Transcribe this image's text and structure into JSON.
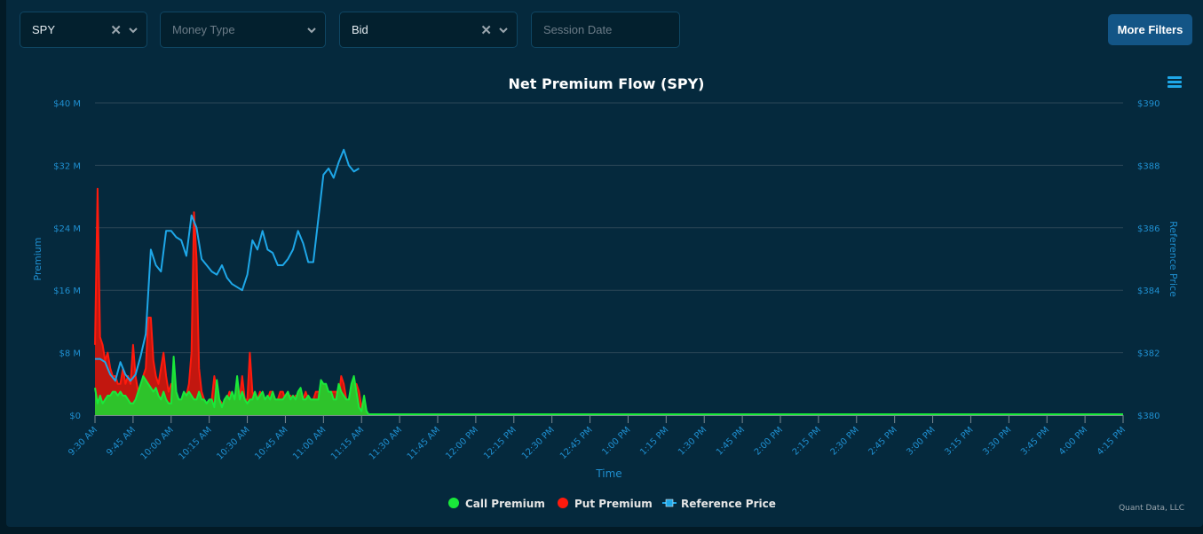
{
  "filters": {
    "ticker": {
      "value": "SPY",
      "clearable": true
    },
    "money_type": {
      "placeholder": "Money Type"
    },
    "side": {
      "value": "Bid",
      "clearable": true
    },
    "session_date": {
      "placeholder": "Session Date"
    },
    "more_filters_label": "More Filters"
  },
  "menu_icon": "hamburger-menu-icon",
  "credit": "Quant Data, LLC",
  "colors": {
    "call": "#19e93a",
    "call_fill": "#2ec32b",
    "put": "#ff1a0d",
    "put_fill": "#c2170f",
    "reference": "#1ea7e8",
    "grid": "#2c4757",
    "axis": "#1f8fd0"
  },
  "chart_data": {
    "type": "area",
    "title": "Net Premium Flow (SPY)",
    "xlabel": "Time",
    "ylabel": "Premium",
    "y2label": "Reference Price",
    "ylim": [
      0,
      40
    ],
    "y_unit": "$M",
    "y2lim": [
      380,
      390
    ],
    "grid": true,
    "legend_position": "bottom-center",
    "y_ticks": [
      "$0",
      "$8 M",
      "$16 M",
      "$24 M",
      "$32 M",
      "$40 M"
    ],
    "y2_ticks": [
      "$380",
      "$382",
      "$384",
      "$386",
      "$388",
      "$390"
    ],
    "x_ticks": [
      "9:30 AM",
      "9:45 AM",
      "10:00 AM",
      "10:15 AM",
      "10:30 AM",
      "10:45 AM",
      "11:00 AM",
      "11:15 AM",
      "11:30 AM",
      "11:45 AM",
      "12:00 PM",
      "12:15 PM",
      "12:30 PM",
      "12:45 PM",
      "1:00 PM",
      "1:15 PM",
      "1:30 PM",
      "1:45 PM",
      "2:00 PM",
      "2:15 PM",
      "2:30 PM",
      "2:45 PM",
      "3:00 PM",
      "3:15 PM",
      "3:30 PM",
      "3:45 PM",
      "4:00 PM",
      "4:15 PM"
    ],
    "x_minutes_range": [
      0,
      405
    ],
    "legend": [
      "Call Premium",
      "Put Premium",
      "Reference Price"
    ],
    "series": [
      {
        "name": "Put Premium",
        "minutes": [
          0,
          1,
          2,
          3,
          4,
          5,
          6,
          7,
          8,
          9,
          10,
          11,
          12,
          13,
          14,
          15,
          16,
          17,
          18,
          19,
          20,
          21,
          22,
          23,
          24,
          25,
          26,
          27,
          28,
          29,
          30,
          31,
          32,
          33,
          34,
          35,
          36,
          37,
          38,
          39,
          40,
          41,
          42,
          43,
          44,
          45,
          46,
          47,
          48,
          49,
          50,
          51,
          52,
          53,
          54,
          55,
          56,
          57,
          58,
          59,
          60,
          61,
          62,
          63,
          64,
          65,
          66,
          67,
          68,
          69,
          70,
          71,
          72,
          73,
          74,
          75,
          76,
          77,
          78,
          79,
          80,
          81,
          82,
          83,
          84,
          85,
          86,
          87,
          88,
          89,
          90,
          91,
          92,
          93,
          94,
          95,
          96,
          97,
          98,
          99,
          100,
          101,
          102,
          103,
          104,
          105,
          106,
          107,
          108
        ],
        "values": [
          9,
          29,
          10,
          9,
          7,
          8,
          6,
          5,
          5,
          4,
          4,
          6,
          4,
          5,
          4,
          9,
          5,
          3,
          3,
          5,
          6,
          12.5,
          12.5,
          7,
          5,
          4,
          6,
          8,
          5,
          3,
          4,
          3,
          2,
          2,
          2,
          2,
          2.5,
          4,
          8,
          26,
          20,
          6,
          3,
          2,
          1.5,
          2,
          2,
          5,
          3,
          2,
          1.5,
          1.5,
          2,
          3,
          2,
          2,
          4,
          2,
          5,
          2,
          2,
          8,
          3,
          2,
          2,
          3,
          2,
          2,
          2,
          3,
          3,
          2,
          2,
          3,
          3,
          2,
          2,
          2.5,
          2,
          2.5,
          2,
          2,
          2,
          3,
          2,
          2,
          2,
          3,
          3,
          3,
          3,
          2,
          2,
          3,
          3,
          3,
          2,
          5,
          4,
          2,
          2,
          3,
          2,
          4,
          3,
          1,
          0.5,
          0.5,
          0
        ],
        "color": "#ff1a0d"
      },
      {
        "name": "Call Premium",
        "minutes": [
          0,
          1,
          2,
          3,
          4,
          5,
          6,
          7,
          8,
          9,
          10,
          11,
          12,
          13,
          14,
          15,
          16,
          17,
          18,
          19,
          20,
          21,
          22,
          23,
          24,
          25,
          26,
          27,
          28,
          29,
          30,
          31,
          32,
          33,
          34,
          35,
          36,
          37,
          38,
          39,
          40,
          41,
          42,
          43,
          44,
          45,
          46,
          47,
          48,
          49,
          50,
          51,
          52,
          53,
          54,
          55,
          56,
          57,
          58,
          59,
          60,
          61,
          62,
          63,
          64,
          65,
          66,
          67,
          68,
          69,
          70,
          71,
          72,
          73,
          74,
          75,
          76,
          77,
          78,
          79,
          80,
          81,
          82,
          83,
          84,
          85,
          86,
          87,
          88,
          89,
          90,
          91,
          92,
          93,
          94,
          95,
          96,
          97,
          98,
          99,
          100,
          101,
          102,
          103,
          104,
          105,
          106,
          107,
          108
        ],
        "values": [
          3.5,
          1.5,
          2.5,
          1.5,
          2,
          2.5,
          2.5,
          3,
          3,
          2.5,
          3,
          2.5,
          2.5,
          2,
          1.5,
          1.5,
          2,
          3,
          4,
          5,
          4.5,
          4,
          3.5,
          3,
          3.5,
          2.5,
          2,
          3,
          2,
          1.5,
          1.5,
          7.5,
          3,
          2,
          2,
          3,
          2.5,
          3,
          2.5,
          2,
          2,
          3,
          2,
          2,
          1.5,
          2,
          2,
          1,
          4.5,
          2,
          1,
          2,
          2.5,
          2,
          3,
          2,
          5,
          2,
          3,
          2,
          1.5,
          2,
          2,
          3,
          2,
          2.5,
          3,
          2,
          2.5,
          2,
          3,
          2,
          2,
          2,
          2,
          2.5,
          3,
          2,
          2.5,
          2,
          3,
          3.5,
          2,
          2,
          2.5,
          2,
          2,
          2,
          2,
          4.5,
          4,
          4,
          3,
          3,
          2,
          2,
          4,
          3,
          2.5,
          2,
          2,
          4,
          5,
          3,
          1,
          0.5,
          2.5,
          0.5,
          0
        ],
        "color": "#19e93a"
      },
      {
        "name": "Reference Price",
        "minutes": [
          0,
          2,
          4,
          6,
          8,
          10,
          12,
          14,
          16,
          18,
          20,
          22,
          24,
          26,
          28,
          30,
          32,
          34,
          36,
          38,
          40,
          42,
          44,
          46,
          48,
          50,
          52,
          54,
          56,
          58,
          60,
          62,
          64,
          66,
          68,
          70,
          72,
          74,
          76,
          78,
          80,
          82,
          84,
          86,
          88,
          90,
          92,
          94,
          96,
          98,
          100,
          102,
          104
        ],
        "values": [
          381.8,
          381.8,
          381.7,
          381.3,
          381.1,
          381.7,
          381.3,
          381.1,
          381.3,
          381.9,
          382.6,
          385.3,
          384.8,
          384.6,
          385.9,
          385.9,
          385.7,
          385.6,
          385.1,
          386.4,
          386.0,
          385.0,
          384.8,
          384.6,
          384.5,
          384.8,
          384.4,
          384.2,
          384.1,
          384.0,
          384.5,
          385.6,
          385.3,
          385.9,
          385.3,
          385.2,
          384.8,
          384.8,
          385.0,
          385.3,
          385.9,
          385.5,
          384.9,
          384.9,
          386.3,
          387.7,
          387.9,
          387.6,
          388.1,
          388.5,
          388.0,
          387.8,
          387.9
        ],
        "color": "#1ea7e8"
      }
    ]
  }
}
